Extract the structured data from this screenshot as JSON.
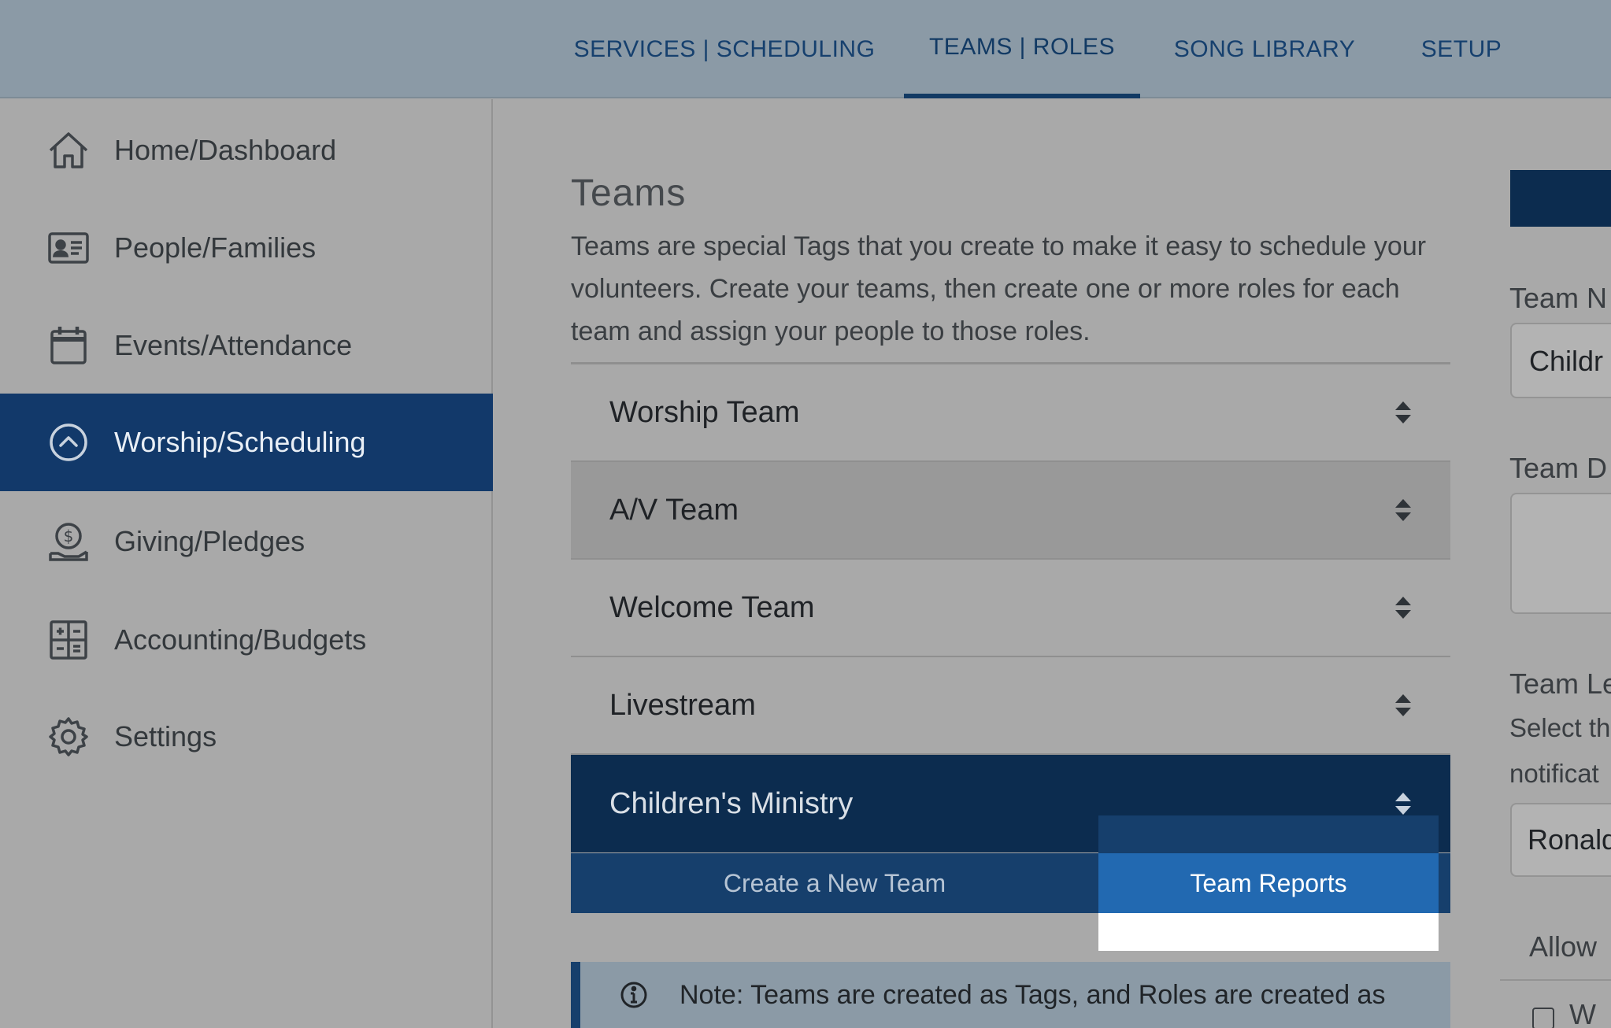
{
  "topnav": {
    "items": [
      {
        "label": "SERVICES | SCHEDULING"
      },
      {
        "label": "TEAMS | ROLES"
      },
      {
        "label": "SONG LIBRARY"
      },
      {
        "label": "SETUP"
      }
    ],
    "active": "TEAMS | ROLES"
  },
  "sidebar": {
    "items": [
      {
        "label": "Home/Dashboard",
        "icon": "home-icon"
      },
      {
        "label": "People/Families",
        "icon": "id-card-icon"
      },
      {
        "label": "Events/Attendance",
        "icon": "calendar-icon"
      },
      {
        "label": "Worship/Scheduling",
        "icon": "chevron-up-circle-icon"
      },
      {
        "label": "Giving/Pledges",
        "icon": "donation-icon"
      },
      {
        "label": "Accounting/Budgets",
        "icon": "calculator-icon"
      },
      {
        "label": "Settings",
        "icon": "gear-icon"
      }
    ],
    "active": "Worship/Scheduling"
  },
  "main": {
    "title": "Teams",
    "description": "Teams are special Tags that you create to make it easy to schedule your volunteers. Create your teams, then create one or more roles for each team and assign your people to those roles.",
    "teams": [
      {
        "name": "Worship Team"
      },
      {
        "name": "A/V Team"
      },
      {
        "name": "Welcome Team"
      },
      {
        "name": "Livestream"
      },
      {
        "name": "Children's Ministry"
      }
    ],
    "selected_team": "Children's Ministry",
    "hovered_team": "A/V Team",
    "create_button": "Create a New Team",
    "reports_button": "Team Reports",
    "note": "Note: Teams are created as Tags, and Roles are created as"
  },
  "right_panel": {
    "team_name_label": "Team N",
    "team_name_value": "Childr",
    "team_desc_label": "Team D",
    "team_leader_label": "Team Le",
    "team_leader_help_1": "Select th",
    "team_leader_help_2": "notificat",
    "team_leader_value": "Ronald",
    "allow_label": "Allow",
    "checkbox_label": "W"
  },
  "colors": {
    "nav_bg": "#8b9aa6",
    "accent_dark": "#0c2c4f",
    "accent": "#163f6c",
    "reports_blue": "#2269b1"
  }
}
